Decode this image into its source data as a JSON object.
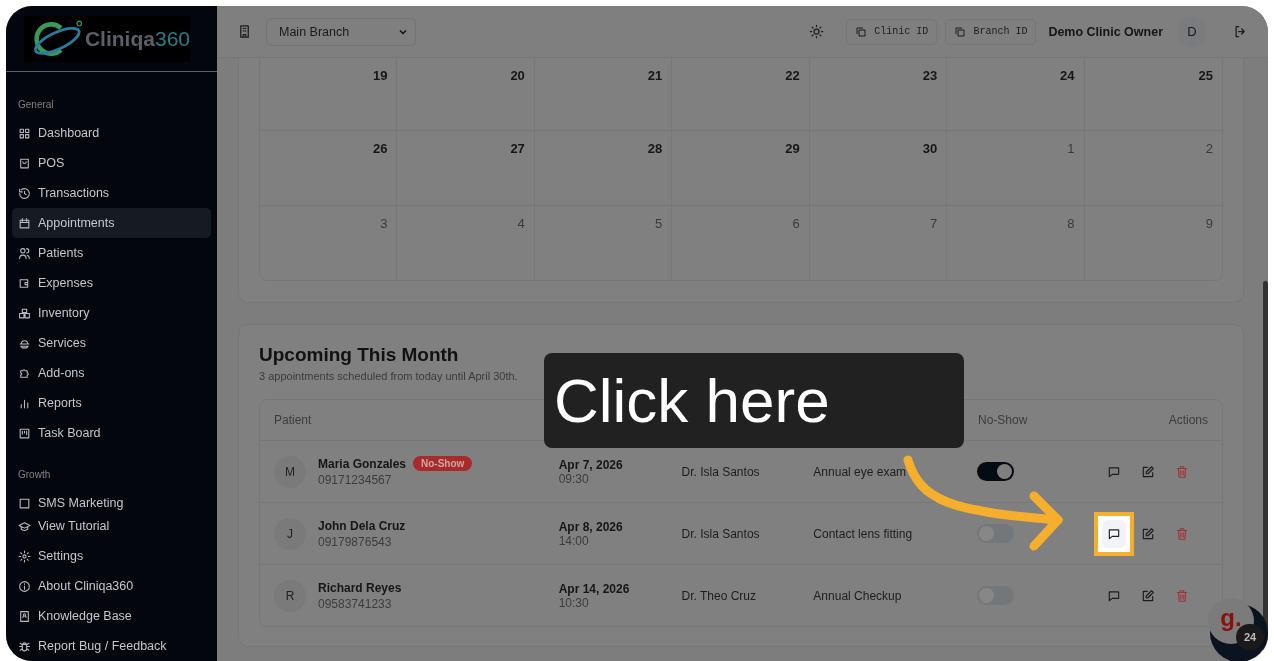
{
  "logo": {
    "text": "Cliniqa",
    "accent": "360"
  },
  "sidebar": {
    "sections": [
      {
        "label": "General",
        "items": [
          {
            "label": "Dashboard",
            "selected": false
          },
          {
            "label": "POS",
            "selected": false
          },
          {
            "label": "Transactions",
            "selected": false
          },
          {
            "label": "Appointments",
            "selected": true
          },
          {
            "label": "Patients",
            "selected": false
          },
          {
            "label": "Expenses",
            "selected": false
          },
          {
            "label": "Inventory",
            "selected": false
          },
          {
            "label": "Services",
            "selected": false
          },
          {
            "label": "Add-ons",
            "selected": false
          },
          {
            "label": "Reports",
            "selected": false
          },
          {
            "label": "Task Board",
            "selected": false
          }
        ]
      },
      {
        "label": "Growth",
        "items": [
          {
            "label": "SMS Marketing",
            "selected": false
          }
        ]
      }
    ],
    "footer_items": [
      "View Tutorial",
      "Settings",
      "About Cliniqa360",
      "Knowledge Base",
      "Report Bug / Feedback"
    ]
  },
  "header": {
    "branch_select": "Main Branch",
    "clinic_id_button": "Clinic ID",
    "branch_id_button": "Branch ID",
    "user_name": "Demo Clinic Owner",
    "avatar_initial": "D"
  },
  "calendar": {
    "weeks": [
      [
        {
          "day": "19",
          "current_month": true
        },
        {
          "day": "20",
          "current_month": true
        },
        {
          "day": "21",
          "current_month": true
        },
        {
          "day": "22",
          "current_month": true
        },
        {
          "day": "23",
          "current_month": true
        },
        {
          "day": "24",
          "current_month": true
        },
        {
          "day": "25",
          "current_month": true
        }
      ],
      [
        {
          "day": "26",
          "current_month": true
        },
        {
          "day": "27",
          "current_month": true
        },
        {
          "day": "28",
          "current_month": true
        },
        {
          "day": "29",
          "current_month": true
        },
        {
          "day": "30",
          "current_month": true
        },
        {
          "day": "1",
          "current_month": false
        },
        {
          "day": "2",
          "current_month": false
        }
      ],
      [
        {
          "day": "3",
          "current_month": false
        },
        {
          "day": "4",
          "current_month": false
        },
        {
          "day": "5",
          "current_month": false
        },
        {
          "day": "6",
          "current_month": false
        },
        {
          "day": "7",
          "current_month": false
        },
        {
          "day": "8",
          "current_month": false
        },
        {
          "day": "9",
          "current_month": false
        }
      ]
    ]
  },
  "upcoming": {
    "title": "Upcoming This Month",
    "subtitle": "3 appointments scheduled from today until April 30th.",
    "columns": {
      "patient": "Patient",
      "no_show": "No-Show",
      "actions": "Actions"
    },
    "rows": [
      {
        "initial": "M",
        "name": "Maria Gonzales",
        "badge": "No-Show",
        "phone": "09171234567",
        "date": "Apr 7, 2026",
        "time": "09:30",
        "doctor": "Dr. Isla Santos",
        "reason": "Annual eye exam",
        "no_show": true,
        "highlighted": false
      },
      {
        "initial": "J",
        "name": "John Dela Cruz",
        "phone": "09179876543",
        "date": "Apr 8, 2026",
        "time": "14:00",
        "doctor": "Dr. Isla Santos",
        "reason": "Contact lens fitting",
        "no_show": false,
        "highlighted": true
      },
      {
        "initial": "R",
        "name": "Richard Reyes",
        "phone": "09583741233",
        "date": "Apr 14, 2026",
        "time": "10:30",
        "doctor": "Dr. Theo Cruz",
        "reason": "Annual Checkup",
        "no_show": false,
        "highlighted": false
      }
    ]
  },
  "guide": {
    "text": "Click here"
  },
  "chat_widget": {
    "logo": "g.",
    "badge": "24"
  }
}
